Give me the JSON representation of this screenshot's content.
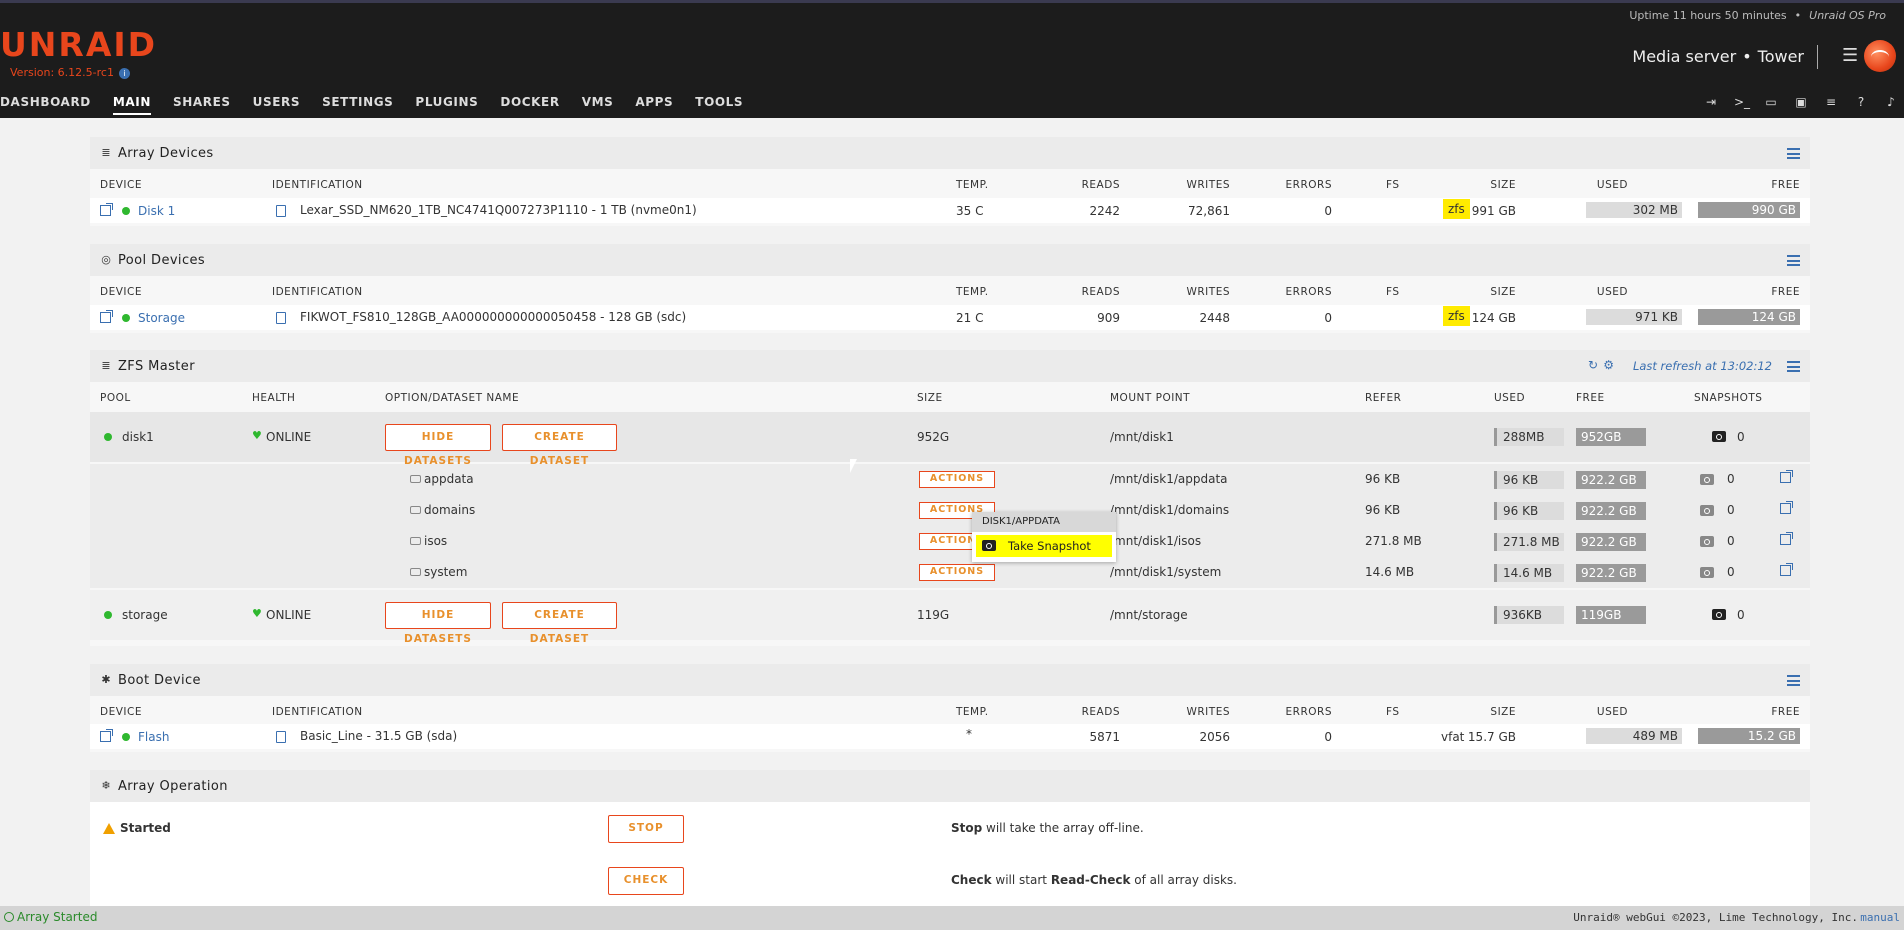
{
  "header": {
    "logo": "UNRAID",
    "version": "Version: 6.12.5-rc1",
    "uptime": "Uptime 11 hours 50 minutes",
    "edition": "Unraid OS Pro",
    "server_desc": "Media server",
    "server_name": "Tower",
    "nav": [
      "DASHBOARD",
      "MAIN",
      "SHARES",
      "USERS",
      "SETTINGS",
      "PLUGINS",
      "DOCKER",
      "VMS",
      "APPS",
      "TOOLS"
    ],
    "nav_active": "MAIN",
    "nav_icons": [
      "logout-icon",
      "terminal-icon",
      "feedback-icon",
      "monitor-icon",
      "log-icon",
      "help-icon",
      "bell-icon"
    ]
  },
  "array_devices": {
    "title": "Array Devices",
    "headers": [
      "DEVICE",
      "IDENTIFICATION",
      "TEMP.",
      "READS",
      "WRITES",
      "ERRORS",
      "FS",
      "SIZE",
      "USED",
      "FREE"
    ],
    "rows": [
      {
        "device": "Disk 1",
        "identification": "Lexar_SSD_NM620_1TB_NC4741Q007273P1110 - 1 TB (nvme0n1)",
        "temp": "35 C",
        "reads": "2242",
        "writes": "72,861",
        "errors": "0",
        "fs": "zfs",
        "size": "991 GB",
        "used": "302 MB",
        "free": "990 GB"
      }
    ]
  },
  "pool_devices": {
    "title": "Pool Devices",
    "headers": [
      "DEVICE",
      "IDENTIFICATION",
      "TEMP.",
      "READS",
      "WRITES",
      "ERRORS",
      "FS",
      "SIZE",
      "USED",
      "FREE"
    ],
    "rows": [
      {
        "device": "Storage",
        "identification": "FIKWOT_FS810_128GB_AA000000000000050458 - 128 GB (sdc)",
        "temp": "21 C",
        "reads": "909",
        "writes": "2448",
        "errors": "0",
        "fs": "zfs",
        "size": "124 GB",
        "used": "971 KB",
        "free": "124 GB"
      }
    ]
  },
  "zfs_master": {
    "title": "ZFS Master",
    "last_refresh": "Last refresh at 13:02:12",
    "headers": [
      "POOL",
      "HEALTH",
      "OPTION/DATASET NAME",
      "SIZE",
      "MOUNT POINT",
      "REFER",
      "USED",
      "FREE",
      "SNAPSHOTS"
    ],
    "hide_label": "HIDE DATASETS",
    "create_label": "CREATE DATASET",
    "actions_label": "ACTIONS",
    "pools": [
      {
        "name": "disk1",
        "health": "ONLINE",
        "size": "952G",
        "mount": "/mnt/disk1",
        "used": "288MB",
        "free": "952GB",
        "snapshots": "0",
        "datasets": [
          {
            "name": "appdata",
            "mount": "/mnt/disk1/appdata",
            "refer": "96 KB",
            "used": "96 KB",
            "free": "922.2 GB",
            "snapshots": "0"
          },
          {
            "name": "domains",
            "mount": "/mnt/disk1/domains",
            "refer": "96 KB",
            "used": "96 KB",
            "free": "922.2 GB",
            "snapshots": "0"
          },
          {
            "name": "isos",
            "mount": "/mnt/disk1/isos",
            "refer": "271.8 MB",
            "used": "271.8 MB",
            "free": "922.2 GB",
            "snapshots": "0"
          },
          {
            "name": "system",
            "mount": "/mnt/disk1/system",
            "refer": "14.6 MB",
            "used": "14.6 MB",
            "free": "922.2 GB",
            "snapshots": "0"
          }
        ]
      },
      {
        "name": "storage",
        "health": "ONLINE",
        "size": "119G",
        "mount": "/mnt/storage",
        "used": "936KB",
        "free": "119GB",
        "snapshots": "0",
        "datasets": []
      }
    ],
    "context_menu": {
      "header": "DISK1/APPDATA",
      "item": "Take Snapshot"
    }
  },
  "boot_device": {
    "title": "Boot Device",
    "headers": [
      "DEVICE",
      "IDENTIFICATION",
      "TEMP.",
      "READS",
      "WRITES",
      "ERRORS",
      "FS",
      "SIZE",
      "USED",
      "FREE"
    ],
    "rows": [
      {
        "device": "Flash",
        "identification": "Basic_Line - 31.5 GB (sda)",
        "temp": "*",
        "reads": "5871",
        "writes": "2056",
        "errors": "0",
        "fs": "vfat",
        "size": "15.7 GB",
        "used": "489 MB",
        "free": "15.2 GB"
      }
    ]
  },
  "array_operation": {
    "title": "Array Operation",
    "status": "Started",
    "stop_label": "STOP",
    "check_label": "CHECK",
    "stop_desc_bold": "Stop",
    "stop_desc": " will take the array off-line.",
    "check_desc_bold": "Check",
    "check_desc_mid": " will start ",
    "check_desc_bold2": "Read-Check",
    "check_desc_end": " of all array disks."
  },
  "footer": {
    "status": "Array Started",
    "copyright": "Unraid® webGui ©2023, Lime Technology, Inc.",
    "manual": "manual"
  },
  "colors": {
    "accent": "#e8461c",
    "link": "#3a6fb0",
    "online": "#2fb82f",
    "fs_highlight": "#ffeb00"
  }
}
